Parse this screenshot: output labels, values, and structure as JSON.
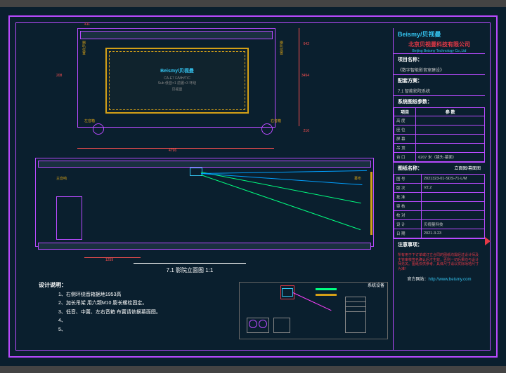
{
  "logo": "Beismy/贝视曼",
  "company": {
    "zh": "北京贝视曼科技有限公司",
    "en": "Beijing Beismy Technology Co.,Ltd"
  },
  "projLabel": "项目名称：",
  "projVal": "《数字智能影音室建设》",
  "schemeLabel": "配套方案：",
  "schemeVal": "7.1 智能影院系统",
  "paramLabel": "系统图纸参数：",
  "paramHead": {
    "c1": "项目",
    "c2": "参 数"
  },
  "params": [
    {
      "k": "高 度",
      "v": ""
    },
    {
      "k": "座 位",
      "v": ""
    },
    {
      "k": "屏 幕",
      "v": ""
    },
    {
      "k": "吊 顶",
      "v": ""
    },
    {
      "k": "台 口",
      "v": "6207 米（镜头-幕面）"
    }
  ],
  "dwgLabel": "图纸名称：",
  "dwgVal": "立面图/幕面图",
  "rows": [
    {
      "k": "图 号",
      "v": "2021323-01-SDS-71-L/M"
    },
    {
      "k": "版 次",
      "v": "V2.2"
    },
    {
      "k": "批 准",
      "v": ""
    },
    {
      "k": "审 核",
      "v": ""
    },
    {
      "k": "校 对",
      "v": ""
    },
    {
      "k": "设 计",
      "v": "贝视曼科技"
    },
    {
      "k": "日 期",
      "v": "2021-3-23"
    }
  ],
  "cautionLabel": "注意事项：",
  "caution": "所有用于下订单或订立合同的图纸均需经过设计师及主管审核签名确认后才生效，否则一切后果均与设计师无关。图纸仅供参考，具体尺寸请以实际场地尺寸为准！",
  "siteLabel": "官方网站：",
  "site": "http://www.beismy.com",
  "fig1": {
    "title": "7.1 影院立面图  1:1",
    "logo": "Beismy/贝视曼",
    "spec1": "CA-E7    F/MH/T/C",
    "spec2": "Sub 低音×1 前置×3 环绕",
    "brand": "贝视曼"
  },
  "dims": {
    "w": "4796",
    "h": "3494",
    "sh": "208",
    "side": "411",
    "top": "642",
    "bot": "216"
  },
  "notes": {
    "t": "设计说明：",
    "n1": "1、右侧环绕音箱据地1953高",
    "n2": "2、加长吊架  用六颗M10 膨长螺栓固定。",
    "n3": "3、低音、中置、左右音箱 布置请依据幕面图。",
    "n4": "4、",
    "n5": "5、"
  },
  "equipTitle": "系统设备",
  "elev2": {
    "dim": "1259"
  },
  "notes_y": {
    "l": "喇叭位置",
    "r": "喇叭位置",
    "bl": "左音箱",
    "br": "右音箱"
  }
}
